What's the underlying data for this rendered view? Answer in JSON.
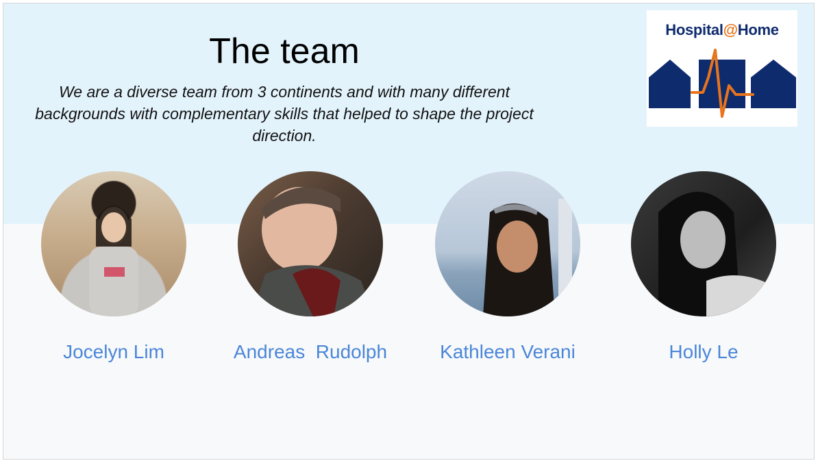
{
  "slide": {
    "title": "The team",
    "subtitle": "We are a diverse team from 3 continents and with many different backgrounds with complementary skills that helped to shape the project direction."
  },
  "logo": {
    "name_part1": "Hospital",
    "at": "@",
    "name_part2": "Home",
    "icon": "heartbeat-houses-logo"
  },
  "members": [
    {
      "name": "Jocelyn Lim",
      "photo": "portrait-photo"
    },
    {
      "name": "Andreas  Rudolph",
      "photo": "portrait-photo"
    },
    {
      "name": "Kathleen Verani",
      "photo": "portrait-photo"
    },
    {
      "name": "Holly Le",
      "photo": "portrait-photo"
    }
  ],
  "colors": {
    "band": "#e3f3fc",
    "name": "#4a86d9",
    "logo_navy": "#0e2b6e",
    "logo_orange": "#e8741c"
  }
}
